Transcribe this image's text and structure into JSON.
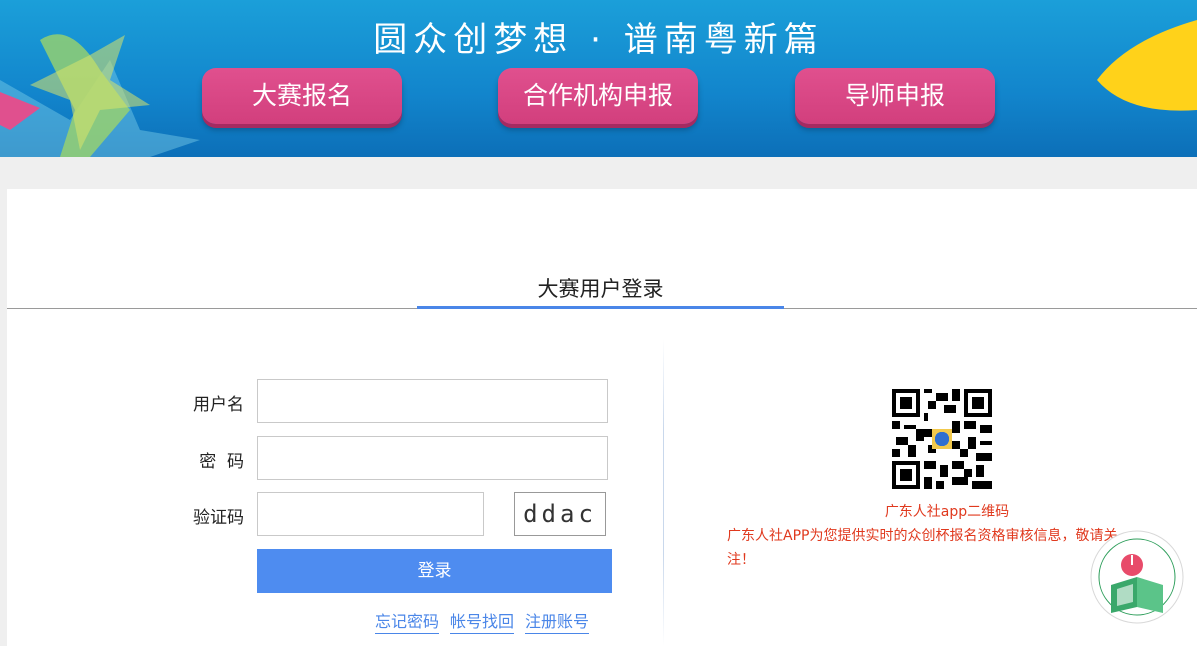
{
  "banner": {
    "slogan": "圆众创梦想 · 谱南粤新篇",
    "buttons": [
      {
        "label": "大赛报名"
      },
      {
        "label": "合作机构申报"
      },
      {
        "label": "导师申报"
      }
    ]
  },
  "login": {
    "title": "大赛用户登录",
    "username_label": "用户名",
    "username_value": "",
    "password_label": "密  码",
    "password_value": "",
    "captcha_label": "验证码",
    "captcha_value": "",
    "captcha_text": "ddac",
    "submit_label": "登录",
    "links": {
      "forgot": "忘记密码",
      "recover": "帐号找回",
      "register": "注册账号"
    }
  },
  "qr": {
    "caption": "广东人社app二维码",
    "description": "广东人社APP为您提供实时的众创杯报名资格审核信息，敬请关注！"
  },
  "colors": {
    "accent": "#4e8cf0",
    "banner_button": "#d23f7d",
    "notice_text": "#e0391e"
  }
}
